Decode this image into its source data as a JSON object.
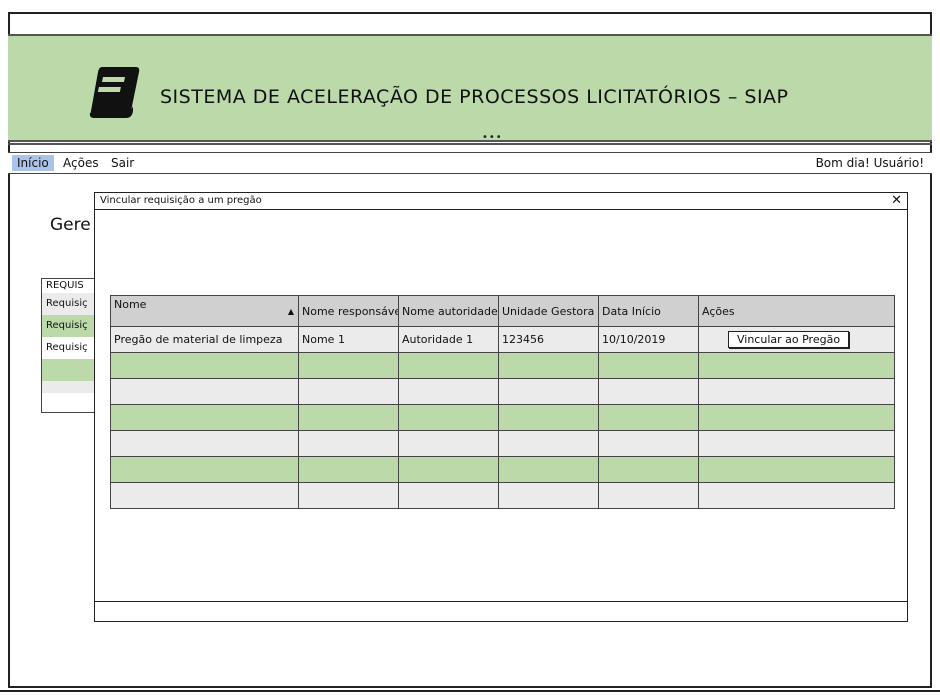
{
  "app": {
    "title": "SISTEMA DE ACELERAÇÃO DE PROCESSOS LICITATÓRIOS – SIAP",
    "splitter": "•••"
  },
  "menu": {
    "items": [
      {
        "label": "Início",
        "active": true
      },
      {
        "label": "Ações",
        "active": false
      },
      {
        "label": "Sair",
        "active": false
      }
    ],
    "greeting": "Bom dia! Usuário!"
  },
  "background_page": {
    "title": "Gere",
    "table_header": "REQUIS",
    "rows": [
      "Requisiç",
      "Requisiç",
      "Requisiç"
    ]
  },
  "dialog": {
    "title": "Vincular requisição a um pregão",
    "close_icon": "close-icon",
    "columns": [
      "Nome",
      "Nome responsável",
      "Nome autoridade",
      "Unidade Gestora",
      "Data Início",
      "Ações"
    ],
    "rows": [
      {
        "nome": "Pregão de material de limpeza",
        "responsavel": "Nome 1",
        "autoridade": "Autoridade 1",
        "unidade": "123456",
        "data": "10/10/2019",
        "acao": "Vincular ao Pregão"
      }
    ]
  },
  "colors": {
    "header_green": "#bcd9a9",
    "row_green": "#bcd9a9",
    "row_gray": "#ebebeb",
    "menu_active": "#a9c4e8"
  }
}
